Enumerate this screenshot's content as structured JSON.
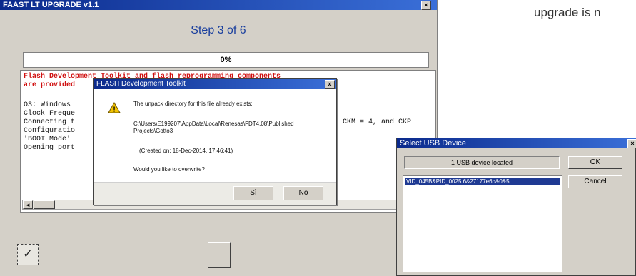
{
  "side_text": "upgrade is n",
  "main_window": {
    "title": "FAAST LT UPGRADE v1.1",
    "close": "×",
    "step": "Step 3 of 6",
    "progress": "0%",
    "log_red_1": "Flash Development Toolkit and flash reprogramming components",
    "log_red_2": "are provided",
    "log_lines": [
      "OS: Windows",
      "Clock Freque",
      "Connecting t",
      "Configuratio",
      "'BOOT Mode'",
      "Opening port"
    ],
    "log_right": "CKM = 4, and CKP",
    "scroll_left": "◄"
  },
  "dialog": {
    "title": "FLASH Development Toolkit",
    "close": "×",
    "line1": "The unpack directory for this file already exists:",
    "path1": "C:\\Users\\E199207\\AppData\\Local\\Renesas\\FDT4.08\\Published",
    "path2": "Projects\\Gotto3",
    "created": "(Created on: 18-Dec-2014, 17:46:41)",
    "question": "Would you like to overwrite?",
    "yes": "Sì",
    "no": "No",
    "warning_glyph": "!"
  },
  "usb_window": {
    "title": "Select USB Device",
    "close": "×",
    "located": "1 USB device located",
    "ok": "OK",
    "cancel": "Cancel",
    "device": "VID_045B&PID_0025 6&27177e6b&0&5"
  },
  "bottom_icon_glyph": "✓"
}
